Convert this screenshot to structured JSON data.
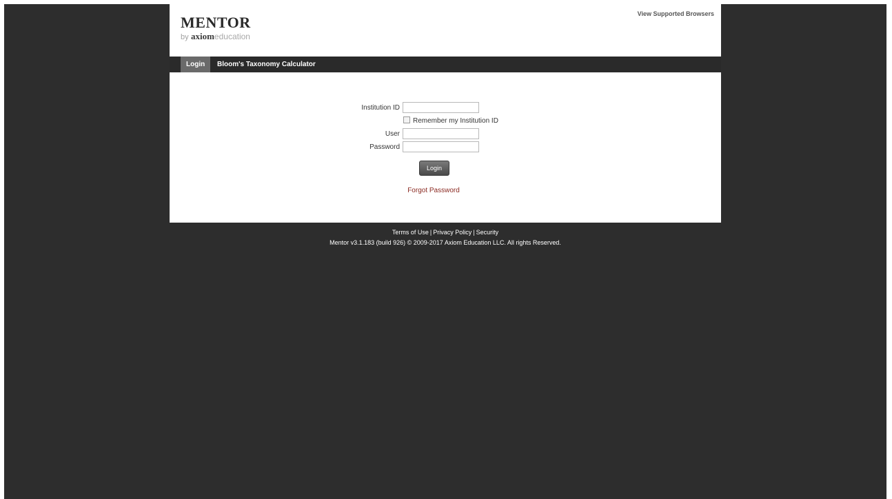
{
  "header": {
    "logo_main": "MENTOR",
    "logo_by": "by",
    "logo_axiom": "axiom",
    "logo_edu": "education",
    "browsers_link": "View Supported Browsers"
  },
  "nav": {
    "items": [
      {
        "label": "Login",
        "active": true
      },
      {
        "label": "Bloom's Taxonomy Calculator",
        "active": false
      }
    ]
  },
  "form": {
    "institution_label": "Institution ID",
    "institution_value": "",
    "remember_label": "Remember my Institution ID",
    "remember_checked": false,
    "user_label": "User",
    "user_value": "",
    "password_label": "Password",
    "password_value": "",
    "login_button": "Login",
    "forgot_link": "Forgot Password"
  },
  "footer": {
    "terms": "Terms of Use",
    "privacy": "Privacy Policy",
    "security": "Security",
    "separator": "|",
    "copyright": "Mentor v3.1.183 (build 926) © 2009-2017 Axiom Education LLC. All rights Reserved."
  },
  "colors": {
    "background": "#2d2d2d",
    "navbar": "#2a2a2a",
    "active_tab": "#6a6a6a",
    "link": "#8b2a22"
  }
}
